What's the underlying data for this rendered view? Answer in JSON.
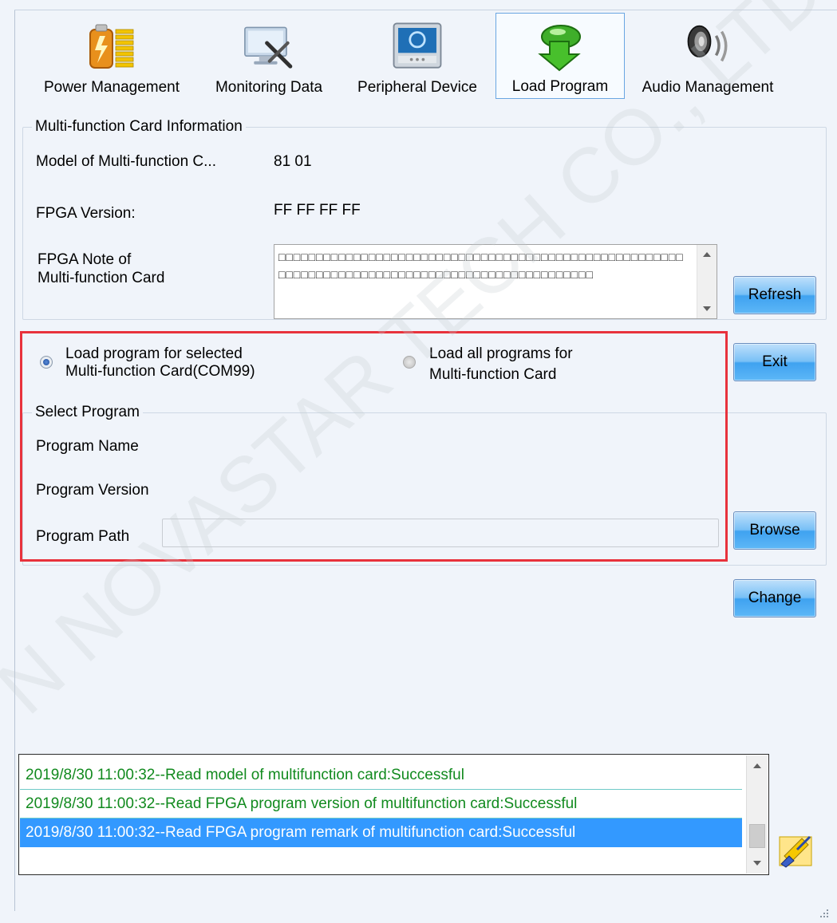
{
  "toolbar": {
    "tabs": [
      {
        "label": "Power Management",
        "icon": "battery-icon"
      },
      {
        "label": "Monitoring Data",
        "icon": "monitor-tools-icon"
      },
      {
        "label": "Peripheral Device",
        "icon": "device-panel-icon"
      },
      {
        "label": "Load Program",
        "icon": "green-arrow-down-icon",
        "selected": true
      },
      {
        "label": "Audio Management",
        "icon": "speaker-icon"
      }
    ]
  },
  "card_info": {
    "title": "Multi-function Card Information",
    "model_label": "Model of Multi-function C...",
    "model_value": "81 01",
    "fpga_version_label": "FPGA Version:",
    "fpga_version_value": "FF FF FF FF",
    "fpga_note_label_line1": "FPGA Note of",
    "fpga_note_label_line2": "Multi-function Card",
    "fpga_note_value": "□□□□□□□□□□□□□□□□□□□□□□□□□□□□□□□□□□□□□□□□□□□□□□□□□□□□□□□□□□□□□□□□□□□□□□□□□□□□□□□□□□□□□□□□□□□□□□□□",
    "refresh_button": "Refresh"
  },
  "load_options": {
    "selected_line1": "Load program for selected",
    "selected_line2": "Multi-function Card(COM99)",
    "selected_checked": true,
    "all_line1": "Load all programs for",
    "all_line2": "Multi-function Card",
    "all_checked": false,
    "exit_button": "Exit"
  },
  "select_program": {
    "title": "Select Program",
    "name_label": "Program Name",
    "version_label": "Program Version",
    "path_label": "Program Path",
    "path_value": "",
    "browse_button": "Browse",
    "change_button": "Change"
  },
  "log": {
    "entries": [
      "2019/8/30 11:00:32--Read model of multifunction card:Successful",
      "2019/8/30 11:00:32--Read FPGA program version of multifunction card:Successful",
      "2019/8/30 11:00:32--Read FPGA program remark of multifunction card:Successful"
    ],
    "selected_index": 2
  },
  "watermark": "N NOVASTAR TECH CO., LTD",
  "colors": {
    "background": "#f0f4fa",
    "highlight_frame": "#e8323c",
    "log_success": "#118a1e",
    "log_selected": "#3399ff",
    "button_blue": "#5db7f7"
  }
}
